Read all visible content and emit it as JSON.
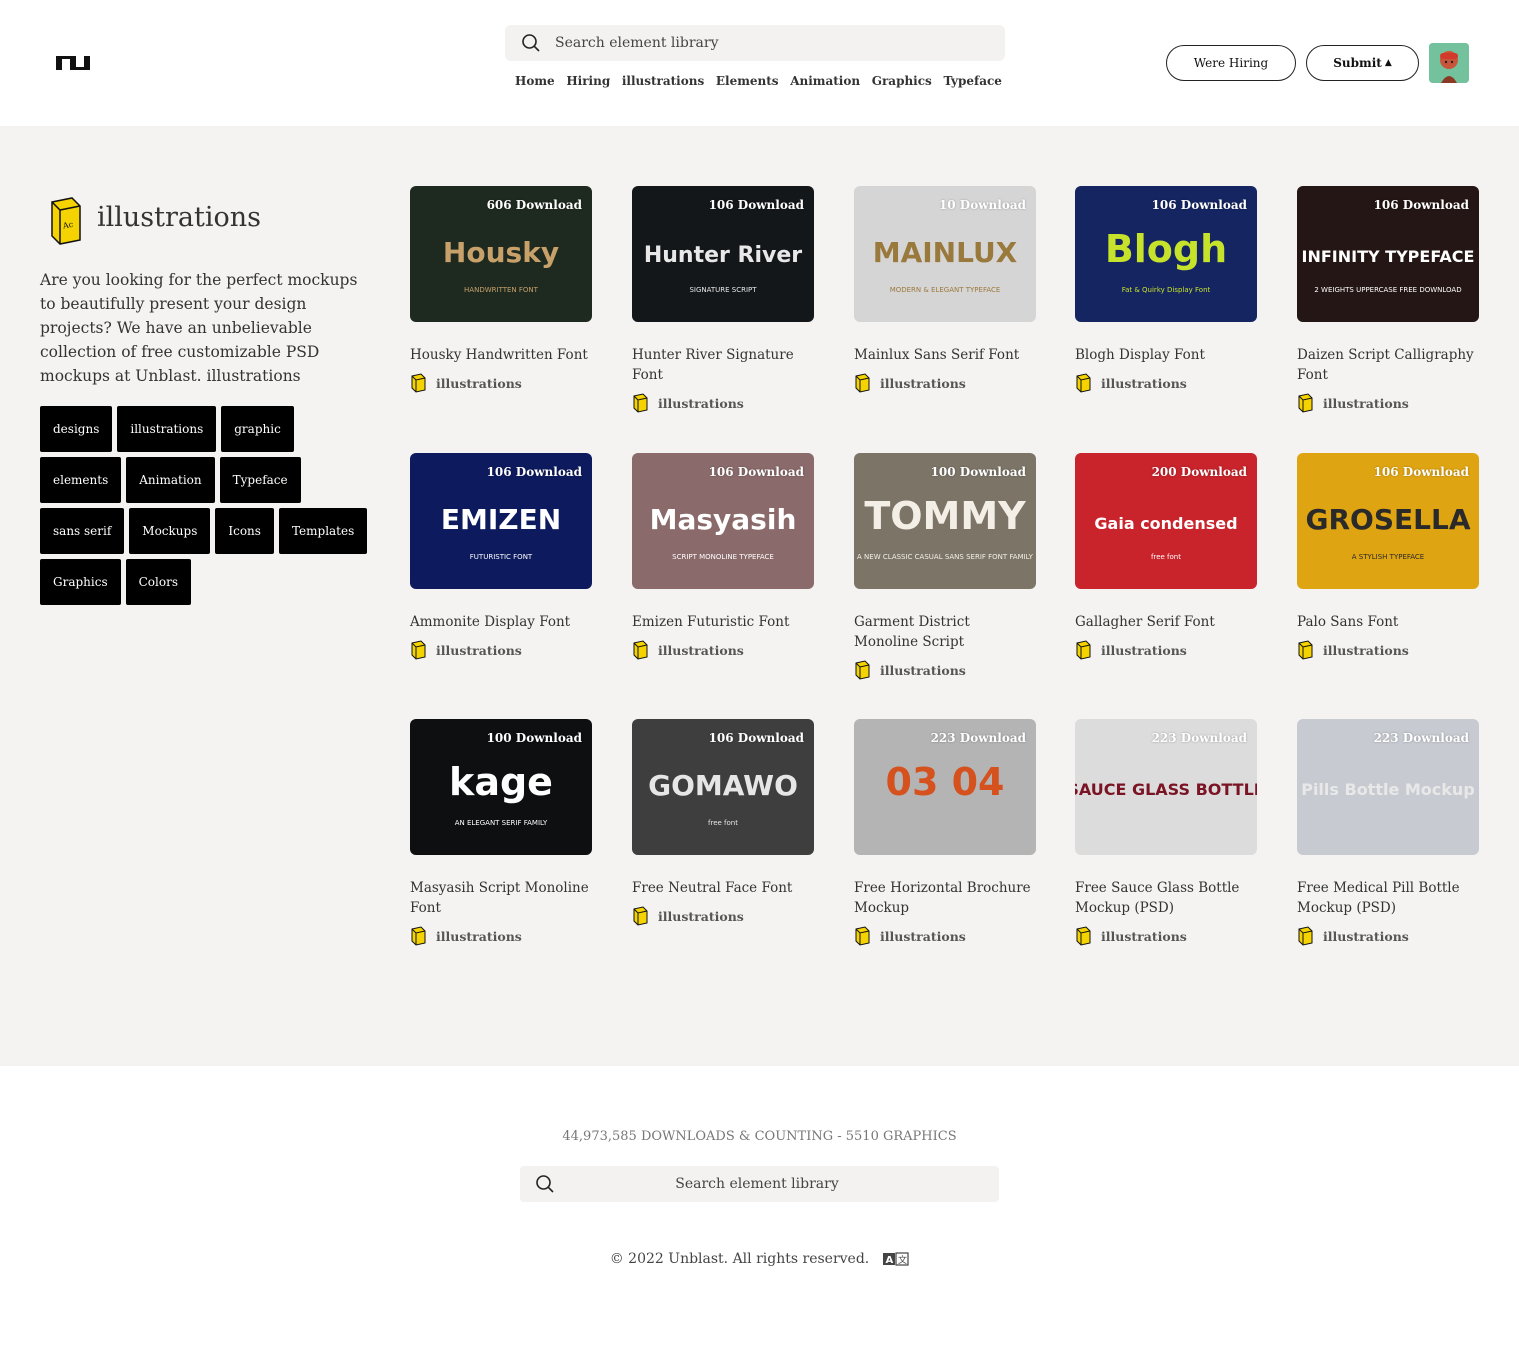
{
  "header": {
    "search_placeholder": "Search element library",
    "nav": [
      "Home",
      "Hiring",
      "illustrations",
      "Elements",
      "Animation",
      "Graphics",
      "Typeface"
    ],
    "hiring_label": "Were Hiring",
    "submit_label": "Submit"
  },
  "category": {
    "title": "illustrations",
    "description": "Are you looking for the perfect mockups to beautifully present your design projects? We have an unbelievable collection of free customizable PSD mockups at Unblast. illustrations",
    "tags": [
      "designs",
      "illustrations",
      "graphic",
      "elements",
      "Animation",
      "Typeface",
      "sans serif",
      "Mockups",
      "Icons",
      "Templates",
      "Graphics",
      "Colors"
    ]
  },
  "cards": [
    {
      "title": "Housky Handwritten Font",
      "downloads": "606 Download",
      "category": "illustrations",
      "thumb_text": "Housky",
      "thumb_sub": "HANDWRITTEN FONT",
      "bg": "#1e2a1f",
      "fg": "#c7a06a"
    },
    {
      "title": "Hunter River Signature Font",
      "downloads": "106 Download",
      "category": "illustrations",
      "thumb_text": "Hunter River",
      "thumb_sub": "SIGNATURE SCRIPT",
      "bg": "#14171a",
      "fg": "#e8e8e8"
    },
    {
      "title": "Mainlux Sans Serif Font",
      "downloads": "10 Download",
      "category": "illustrations",
      "thumb_text": "MAINLUX",
      "thumb_sub": "MODERN & ELEGANT TYPEFACE",
      "bg": "#d6d5d6",
      "fg": "#9a7a3c"
    },
    {
      "title": "Blogh Display Font",
      "downloads": "106 Download",
      "category": "illustrations",
      "thumb_text": "Blogh",
      "thumb_sub": "Fat & Quirky Display Font",
      "bg": "#152562",
      "fg": "#c6e22a"
    },
    {
      "title": "Daizen Script Calligraphy Font",
      "downloads": "106 Download",
      "category": "illustrations",
      "thumb_text": "INFINITY TYPEFACE",
      "thumb_sub": "2 WEIGHTS UPPERCASE FREE DOWNLOAD",
      "bg": "#241614",
      "fg": "#ffffff"
    },
    {
      "title": "Ammonite Display Font",
      "downloads": "106 Download",
      "category": "illustrations",
      "thumb_text": "EMIZEN",
      "thumb_sub": "FUTURISTIC FONT",
      "bg": "#0d1a5e",
      "fg": "#ffffff"
    },
    {
      "title": "Emizen Futuristic Font",
      "downloads": "106 Download",
      "category": "illustrations",
      "thumb_text": "Masyasih",
      "thumb_sub": "SCRIPT MONOLINE TYPEFACE",
      "bg": "#8a6a6a",
      "fg": "#ffffff"
    },
    {
      "title": "Garment District Monoline Script",
      "downloads": "100 Download",
      "category": "illustrations",
      "thumb_text": "TOMMY",
      "thumb_sub": "A NEW CLASSIC CASUAL SANS SERIF FONT FAMILY",
      "bg": "#7c7567",
      "fg": "#f4efe6"
    },
    {
      "title": "Gallagher Serif Font",
      "downloads": "200 Download",
      "category": "illustrations",
      "thumb_text": "Gaia condensed",
      "thumb_sub": "free font",
      "bg": "#c9232b",
      "fg": "#ffffff"
    },
    {
      "title": "Palo Sans Font",
      "downloads": "106 Download",
      "category": "illustrations",
      "thumb_text": "GROSELLA",
      "thumb_sub": "A STYLISH TYPEFACE",
      "bg": "#dfa412",
      "fg": "#2a2a2a"
    },
    {
      "title": "Masyasih Script Monoline Font",
      "downloads": "100 Download",
      "category": "illustrations",
      "thumb_text": "kage",
      "thumb_sub": "AN ELEGANT SERIF FAMILY",
      "bg": "#0d0f10",
      "fg": "#ffffff"
    },
    {
      "title": "Free Neutral Face Font",
      "downloads": "106 Download",
      "category": "illustrations",
      "thumb_text": "GOMAWO",
      "thumb_sub": "free font",
      "bg": "#3e3e3e",
      "fg": "#e6e6e6"
    },
    {
      "title": "Free Horizontal Brochure Mockup",
      "downloads": "223 Download",
      "category": "illustrations",
      "thumb_text": "03 04",
      "thumb_sub": "",
      "bg": "#b4b4b4",
      "fg": "#d5511e"
    },
    {
      "title": "Free Sauce Glass Bottle Mockup (PSD)",
      "downloads": "223 Download",
      "category": "illustrations",
      "thumb_text": "SAUCE GLASS BOTTLE",
      "thumb_sub": "",
      "bg": "#dcdcdc",
      "fg": "#7a1424"
    },
    {
      "title": "Free Medical Pill Bottle Mockup (PSD)",
      "downloads": "223 Download",
      "category": "illustrations",
      "thumb_text": "Pills Bottle Mockup",
      "thumb_sub": "",
      "bg": "#c7cbd1",
      "fg": "#e8e8e8"
    }
  ],
  "footer": {
    "stats": "44,973,585 DOWNLOADS & COUNTING - 5510 GRAPHICS",
    "search_placeholder": "Search element library",
    "copyright": "© 2022 Unblast. All rights reserved."
  },
  "colors": {
    "accent": "#000000",
    "page_bg": "#f4f3f2",
    "category_icon": "#f5d300"
  }
}
